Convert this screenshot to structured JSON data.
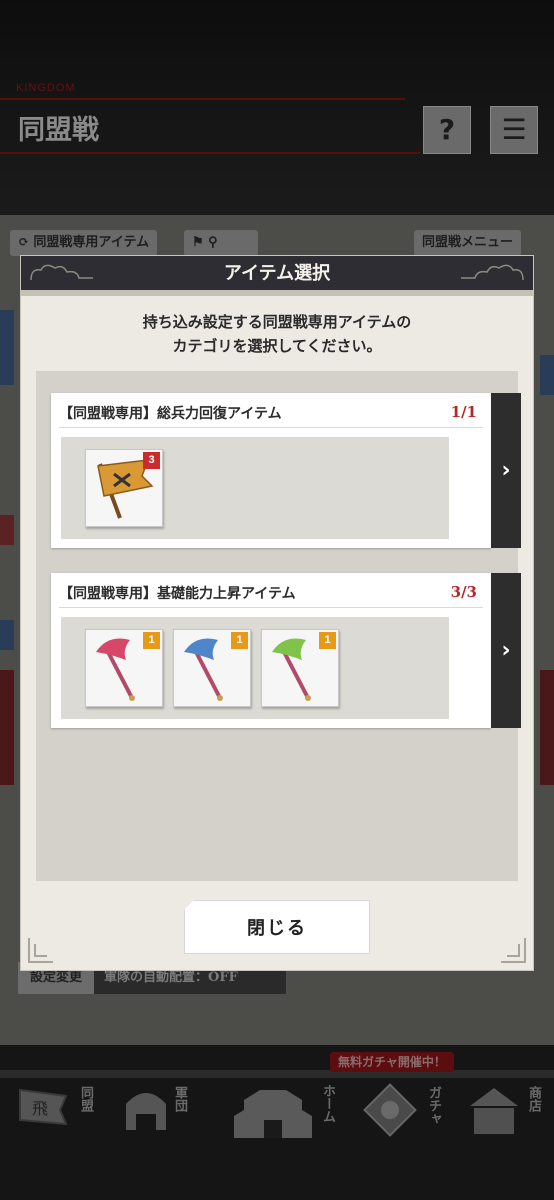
{
  "background": {
    "kingdom_label": "KINGDOM",
    "page_title": "同盟戦",
    "help_label": "?",
    "menu_label": "☰",
    "tag_item": "同盟戦専用アイテム",
    "tag_menu": "同盟戦メニュー",
    "settings_chip": "設定変更",
    "settings_text": "軍隊の自動配置：OFF",
    "promo_text": "無料ガチャ開催中！",
    "nav": [
      {
        "label": "同盟",
        "icon": "flag-icon"
      },
      {
        "label": "軍団",
        "icon": "helmet-icon"
      },
      {
        "label": "ホーム",
        "icon": "castle-icon"
      },
      {
        "label": "ガチャ",
        "icon": "crest-icon"
      },
      {
        "label": "商店",
        "icon": "shop-icon"
      }
    ]
  },
  "dialog": {
    "title": "アイテム選択",
    "instruction_line1": "持ち込み設定する同盟戦専用アイテムの",
    "instruction_line2": "カテゴリを選択してください。",
    "categories": [
      {
        "title": "【同盟戦専用】総兵力回復アイテム",
        "count": "1/1",
        "items": [
          {
            "icon": "war-banner-icon",
            "badge": "3",
            "badge_color": "#cc2b2b"
          }
        ]
      },
      {
        "title": "【同盟戦専用】基礎能力上昇アイテム",
        "count": "3/3",
        "items": [
          {
            "icon": "red-tassel-flag-icon",
            "badge": "1",
            "badge_color": "#e69a17",
            "color": "#d8466a"
          },
          {
            "icon": "blue-tassel-flag-icon",
            "badge": "1",
            "badge_color": "#e69a17",
            "color": "#4f86c9"
          },
          {
            "icon": "green-tassel-flag-icon",
            "badge": "1",
            "badge_color": "#e69a17",
            "color": "#7fc34a"
          }
        ]
      }
    ],
    "close_label": "閉じる"
  }
}
